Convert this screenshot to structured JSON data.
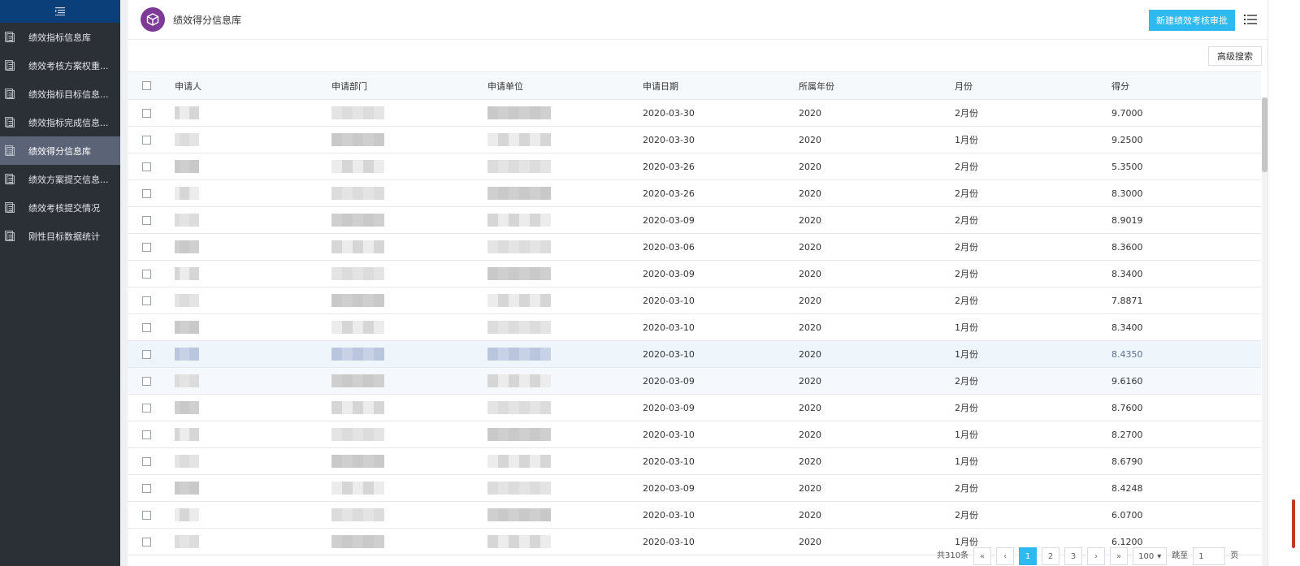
{
  "sidebar": {
    "items": [
      {
        "label": "绩效指标信息库",
        "active": false
      },
      {
        "label": "绩效考核方案权重...",
        "active": false
      },
      {
        "label": "绩效指标目标信息...",
        "active": false
      },
      {
        "label": "绩效指标完成信息...",
        "active": false
      },
      {
        "label": "绩效得分信息库",
        "active": true
      },
      {
        "label": "绩效方案提交信息...",
        "active": false
      },
      {
        "label": "绩效考核提交情况",
        "active": false
      },
      {
        "label": "刚性目标数据统计",
        "active": false
      }
    ]
  },
  "header": {
    "title": "绩效得分信息库",
    "new_button": "新建绩效考核审批",
    "advanced_search": "高级搜索",
    "logo_color": "#7d3a97",
    "accent_color": "#2eb9f0"
  },
  "table": {
    "columns": [
      "申请人",
      "申请部门",
      "申请单位",
      "申请日期",
      "所属年份",
      "月份",
      "得分"
    ],
    "rows": [
      {
        "date": "2020-03-30",
        "year": "2020",
        "month": "2月份",
        "score": "9.7000"
      },
      {
        "date": "2020-03-30",
        "year": "2020",
        "month": "1月份",
        "score": "9.2500"
      },
      {
        "date": "2020-03-26",
        "year": "2020",
        "month": "2月份",
        "score": "5.3500"
      },
      {
        "date": "2020-03-26",
        "year": "2020",
        "month": "2月份",
        "score": "8.3000"
      },
      {
        "date": "2020-03-09",
        "year": "2020",
        "month": "2月份",
        "score": "8.9019"
      },
      {
        "date": "2020-03-06",
        "year": "2020",
        "month": "2月份",
        "score": "8.3600"
      },
      {
        "date": "2020-03-09",
        "year": "2020",
        "month": "2月份",
        "score": "8.3400"
      },
      {
        "date": "2020-03-10",
        "year": "2020",
        "month": "2月份",
        "score": "7.8871"
      },
      {
        "date": "2020-03-10",
        "year": "2020",
        "month": "1月份",
        "score": "8.3400"
      },
      {
        "date": "2020-03-10",
        "year": "2020",
        "month": "1月份",
        "score": "8.4350"
      },
      {
        "date": "2020-03-09",
        "year": "2020",
        "month": "2月份",
        "score": "9.6160"
      },
      {
        "date": "2020-03-09",
        "year": "2020",
        "month": "2月份",
        "score": "8.7600"
      },
      {
        "date": "2020-03-10",
        "year": "2020",
        "month": "1月份",
        "score": "8.2700"
      },
      {
        "date": "2020-03-10",
        "year": "2020",
        "month": "1月份",
        "score": "8.6790"
      },
      {
        "date": "2020-03-09",
        "year": "2020",
        "month": "2月份",
        "score": "8.4248"
      },
      {
        "date": "2020-03-10",
        "year": "2020",
        "month": "2月份",
        "score": "6.0700"
      },
      {
        "date": "2020-03-10",
        "year": "2020",
        "month": "1月份",
        "score": "6.1200"
      }
    ]
  },
  "pagination": {
    "total": "共310条",
    "pages": [
      "1",
      "2",
      "3"
    ],
    "current": "1",
    "page_size": "100",
    "goto_label": "跳至",
    "goto_value": "1",
    "page_unit": "页"
  }
}
